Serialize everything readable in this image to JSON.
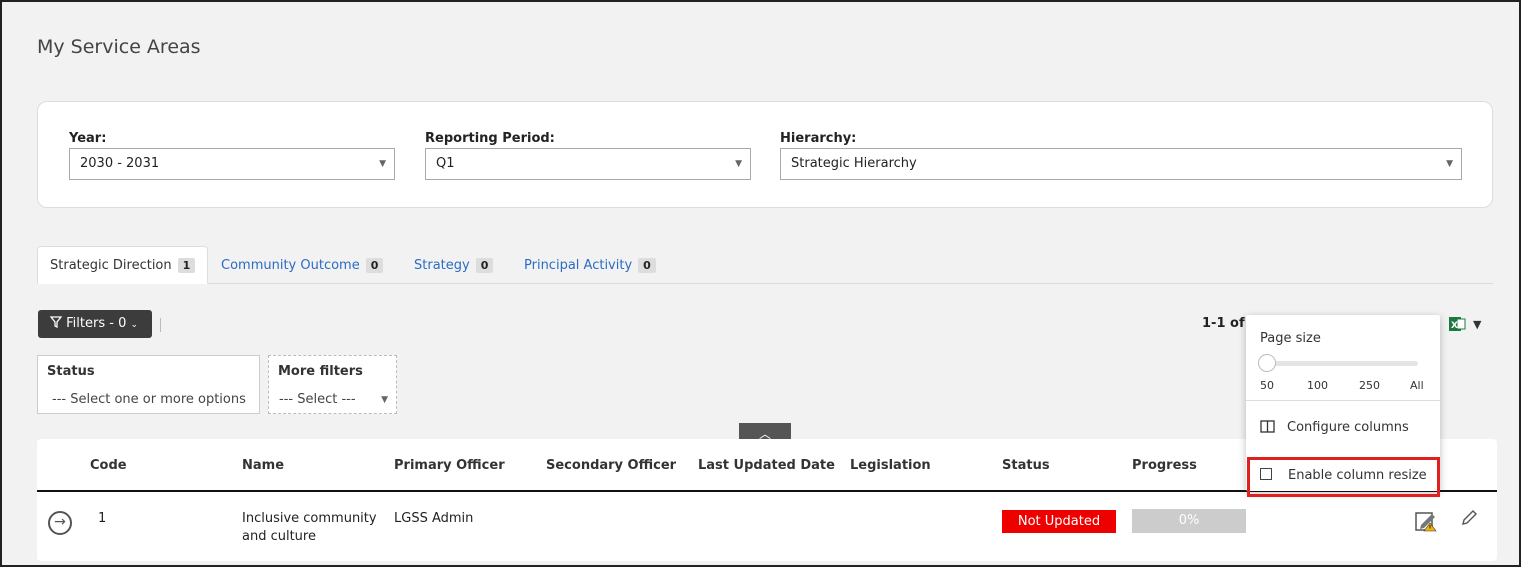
{
  "page": {
    "title": "My Service Areas"
  },
  "filters_card": {
    "year_label": "Year:",
    "year_value": "2030 - 2031",
    "period_label": "Reporting Period:",
    "period_value": "Q1",
    "hierarchy_label": "Hierarchy:",
    "hierarchy_value": "Strategic Hierarchy"
  },
  "tabs": [
    {
      "label": "Strategic Direction",
      "count": "1"
    },
    {
      "label": "Community Outcome",
      "count": "0"
    },
    {
      "label": "Strategy",
      "count": "0"
    },
    {
      "label": "Principal Activity",
      "count": "0"
    }
  ],
  "toolbar": {
    "filters_label": "Filters - 0",
    "pager_text": "1-1 of 1"
  },
  "filter_fields": {
    "status_label": "Status",
    "status_placeholder": "--- Select one or more options",
    "more_label": "More filters",
    "more_placeholder": "--- Select ---"
  },
  "grid": {
    "columns": [
      "Code",
      "Name",
      "Primary Officer",
      "Secondary Officer",
      "Last Updated Date",
      "Legislation",
      "Status",
      "Progress"
    ],
    "rows": [
      {
        "code": "1",
        "name_line1": "Inclusive community",
        "name_line2": "and culture",
        "primary_officer": "LGSS Admin",
        "status": "Not Updated",
        "progress": "0%"
      }
    ]
  },
  "dropdown": {
    "page_size_label": "Page size",
    "ticks": [
      "50",
      "100",
      "250",
      "All"
    ],
    "configure_columns": "Configure columns",
    "enable_resize": "Enable column resize"
  },
  "colors": {
    "status_not_updated": "#ee0000",
    "link": "#2b6cc4",
    "highlight": "#e02020",
    "excel": "#1d7a3e"
  }
}
